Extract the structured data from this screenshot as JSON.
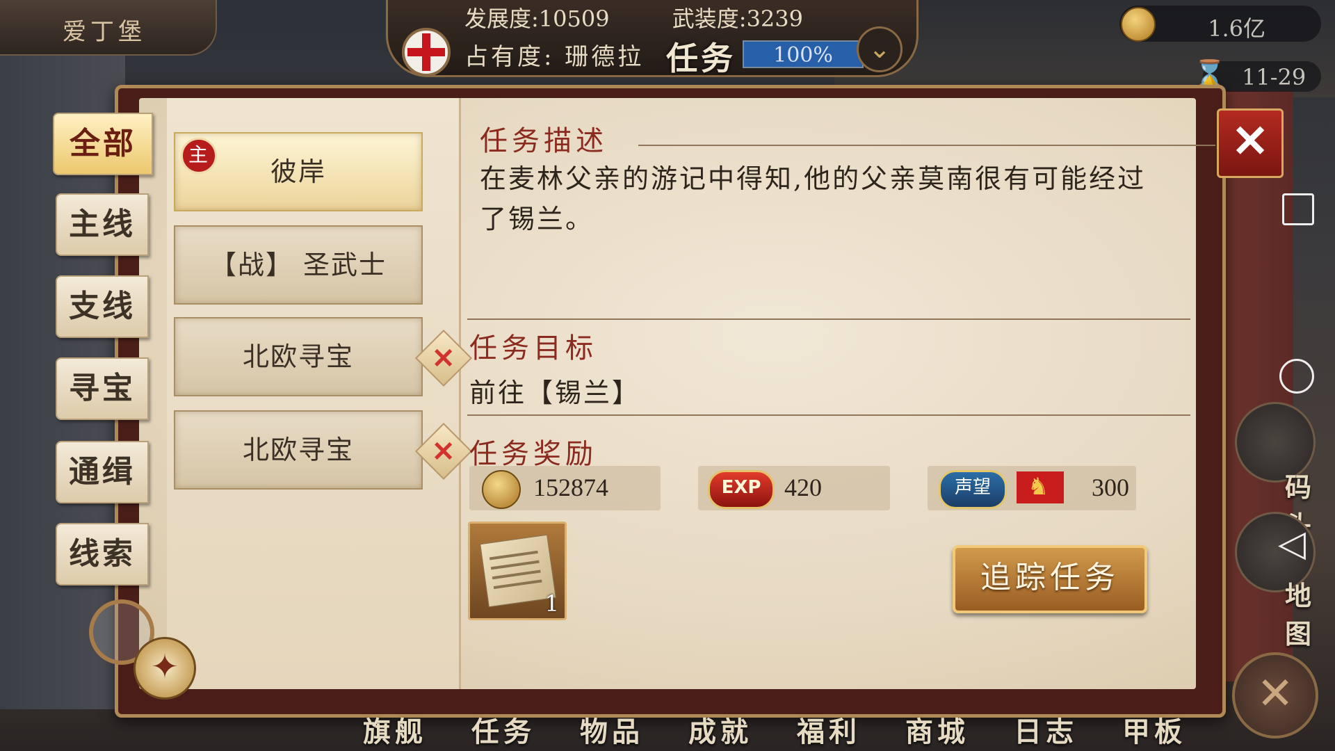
{
  "city": {
    "name": "爱丁堡"
  },
  "stats": {
    "development_label": "发展度:",
    "development_value": "10509",
    "armament_label": "武装度:",
    "armament_value": "3239",
    "occupancy_label": "占有度:",
    "occupancy_owner": "珊德拉",
    "occupancy_percent": "100%",
    "occupancy_fraction": 1.0
  },
  "overlay_title": "任务",
  "resources": {
    "gold": "1.6亿",
    "date": "11-29"
  },
  "categories": [
    {
      "label": "全部",
      "active": true
    },
    {
      "label": "主线",
      "active": false
    },
    {
      "label": "支线",
      "active": false
    },
    {
      "label": "寻宝",
      "active": false
    },
    {
      "label": "通缉",
      "active": false
    },
    {
      "label": "线索",
      "active": false
    }
  ],
  "quests": [
    {
      "title": "彼岸",
      "badge": "主",
      "active": true
    },
    {
      "title": "【战】 圣武士",
      "active": false
    },
    {
      "title": "北欧寻宝",
      "active": false
    },
    {
      "title": "北欧寻宝",
      "active": false
    }
  ],
  "detail": {
    "description_title": "任务描述",
    "description": "在麦林父亲的游记中得知,他的父亲莫南很有可能经过了锡兰。",
    "target_title": "任务目标",
    "target": "前往【锡兰】",
    "reward_title": "任务奖励",
    "rewards": {
      "gold": "152874",
      "exp_badge": "EXP",
      "exp": "420",
      "fame_badge": "声望",
      "fame": "300"
    },
    "item_count": "1",
    "track_button": "追踪任务"
  },
  "close_symbol": "✕",
  "side_nav": {
    "dock": "码头",
    "map": "地图"
  },
  "bottom_nav": [
    "旗舰",
    "任务",
    "物品",
    "成就",
    "福利",
    "商城",
    "日志",
    "甲板"
  ],
  "colors": {
    "accent_red": "#8b2a1e",
    "panel_border": "#b08a56",
    "button_gold": "#d19a4c"
  }
}
